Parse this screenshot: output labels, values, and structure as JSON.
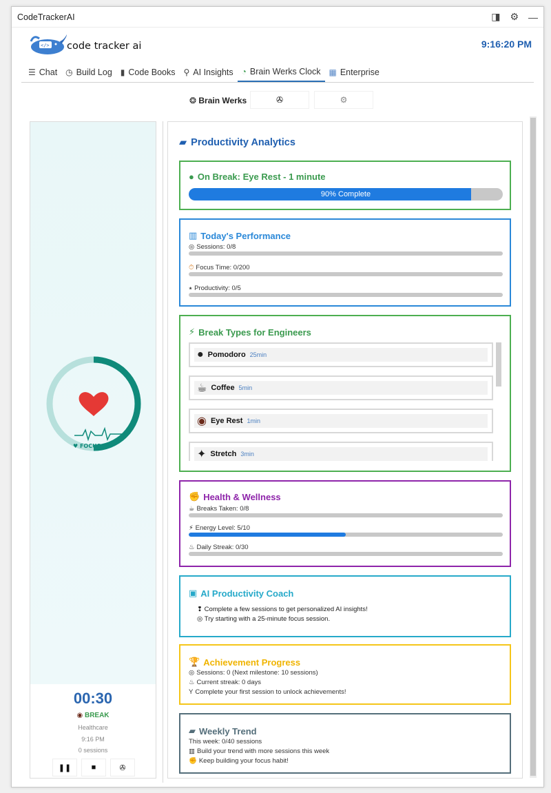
{
  "window": {
    "title": "CodeTrackerAI"
  },
  "header": {
    "logo_text": "code tracker ai",
    "clock": "9:16:20 PM"
  },
  "tabs": [
    {
      "label": "Chat",
      "icon": "chat-lines-icon"
    },
    {
      "label": "Build Log",
      "icon": "clock-icon"
    },
    {
      "label": "Code Books",
      "icon": "book-icon"
    },
    {
      "label": "AI Insights",
      "icon": "magnifier-icon"
    },
    {
      "label": "Brain Werks Clock",
      "icon": "timer-play-icon"
    },
    {
      "label": "Enterprise",
      "icon": "building-icon"
    }
  ],
  "subtoolbar": {
    "label": "Brain Werks"
  },
  "focus_panel": {
    "ring_label": "♥ FOCUS",
    "timer": "00:30",
    "state": "BREAK",
    "category": "Healthcare",
    "time": "9:16 PM",
    "sessions": "0 sessions"
  },
  "analytics": {
    "title": "Productivity Analytics",
    "status_card": {
      "title": "On Break: Eye Rest - 1 minute",
      "progress_text": "90% Complete",
      "progress": 0.9,
      "color": "#4caf50"
    },
    "performance": {
      "title": "Today's Performance",
      "color": "#2a88d8",
      "items": [
        {
          "label": "Sessions: 0/8",
          "value": 0
        },
        {
          "label": "Focus Time: 0/200",
          "value": 0
        },
        {
          "label": "Productivity: 0/5",
          "value": 0
        }
      ]
    },
    "break_types": {
      "title": "Break Types for Engineers",
      "color": "#4caf50",
      "items": [
        {
          "name": "Pomodoro",
          "duration": "25min",
          "icon": "tomato-icon"
        },
        {
          "name": "Coffee",
          "duration": "5min",
          "icon": "coffee-icon"
        },
        {
          "name": "Eye Rest",
          "duration": "1min",
          "icon": "eye-icon"
        },
        {
          "name": "Stretch",
          "duration": "3min",
          "icon": "stretch-icon"
        }
      ]
    },
    "health": {
      "title": "Health & Wellness",
      "color": "#8e24aa",
      "items": [
        {
          "label": "Breaks Taken: 0/8",
          "value": 0
        },
        {
          "label": "Energy Level: 5/10",
          "value": 0.5
        },
        {
          "label": "Daily Streak: 0/30",
          "value": 0
        }
      ]
    },
    "coach": {
      "title": "AI Productivity Coach",
      "color": "#26a9c9",
      "lines": [
        "Complete a few sessions to get personalized AI insights!",
        "Try starting with a 25-minute focus session."
      ]
    },
    "achievement": {
      "title": "Achievement Progress",
      "color": "#f5c518",
      "lines": [
        "Sessions: 0 (Next milestone: 10 sessions)",
        "Current streak: 0 days",
        "Complete your first session to unlock achievements!"
      ]
    },
    "trend": {
      "title": "Weekly Trend",
      "color": "#546e7a",
      "lines": [
        "This week: 0/40 sessions",
        "Build your trend with more sessions this week",
        "Keep building your focus habit!"
      ]
    }
  }
}
